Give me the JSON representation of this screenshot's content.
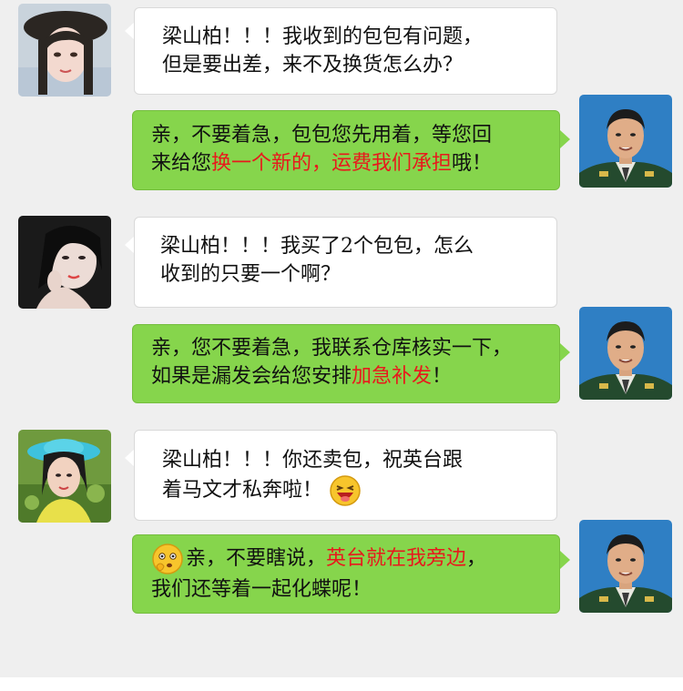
{
  "messages": [
    {
      "sender": "customer",
      "avatar": "woman-hat-avatar",
      "lines": [
        "梁山柏！！！我收到的包包有问题，",
        "但是要出差，来不及换货怎么办？"
      ]
    },
    {
      "sender": "agent",
      "avatar": "officer-avatar",
      "line1": "亲，不要着急，包包您先用着，等您回",
      "line2_pre": "来给您",
      "line2_hl": "换一个新的，运费我们承担",
      "line2_post": "哦！"
    },
    {
      "sender": "customer",
      "avatar": "woman-dark-avatar",
      "lines": [
        "梁山柏！！！我买了2个包包，怎么",
        "收到的只要一个啊？"
      ]
    },
    {
      "sender": "agent",
      "avatar": "officer-avatar",
      "line1": "亲，您不要着急，我联系仓库核实一下，",
      "line2_pre": "如果是漏发会给您安排",
      "line2_hl": "加急补发",
      "line2_post": "！"
    },
    {
      "sender": "customer",
      "avatar": "woman-blue-hat-avatar",
      "line1": "梁山柏！！！你还卖包，祝英台跟",
      "line2": "着马文才私奔啦！",
      "emoji": "laughing-emoji"
    },
    {
      "sender": "agent",
      "avatar": "officer-avatar",
      "emoji": "thinking-emoji",
      "line1_pre": "亲，不要瞎说，",
      "line1_hl": "英台就在我旁边",
      "line1_post": "，",
      "line2": "我们还等着一起化蝶呢！"
    }
  ],
  "colors": {
    "background": "#efefef",
    "customer_bubble": "#ffffff",
    "agent_bubble": "#86d54c",
    "highlight": "#e8191c"
  }
}
